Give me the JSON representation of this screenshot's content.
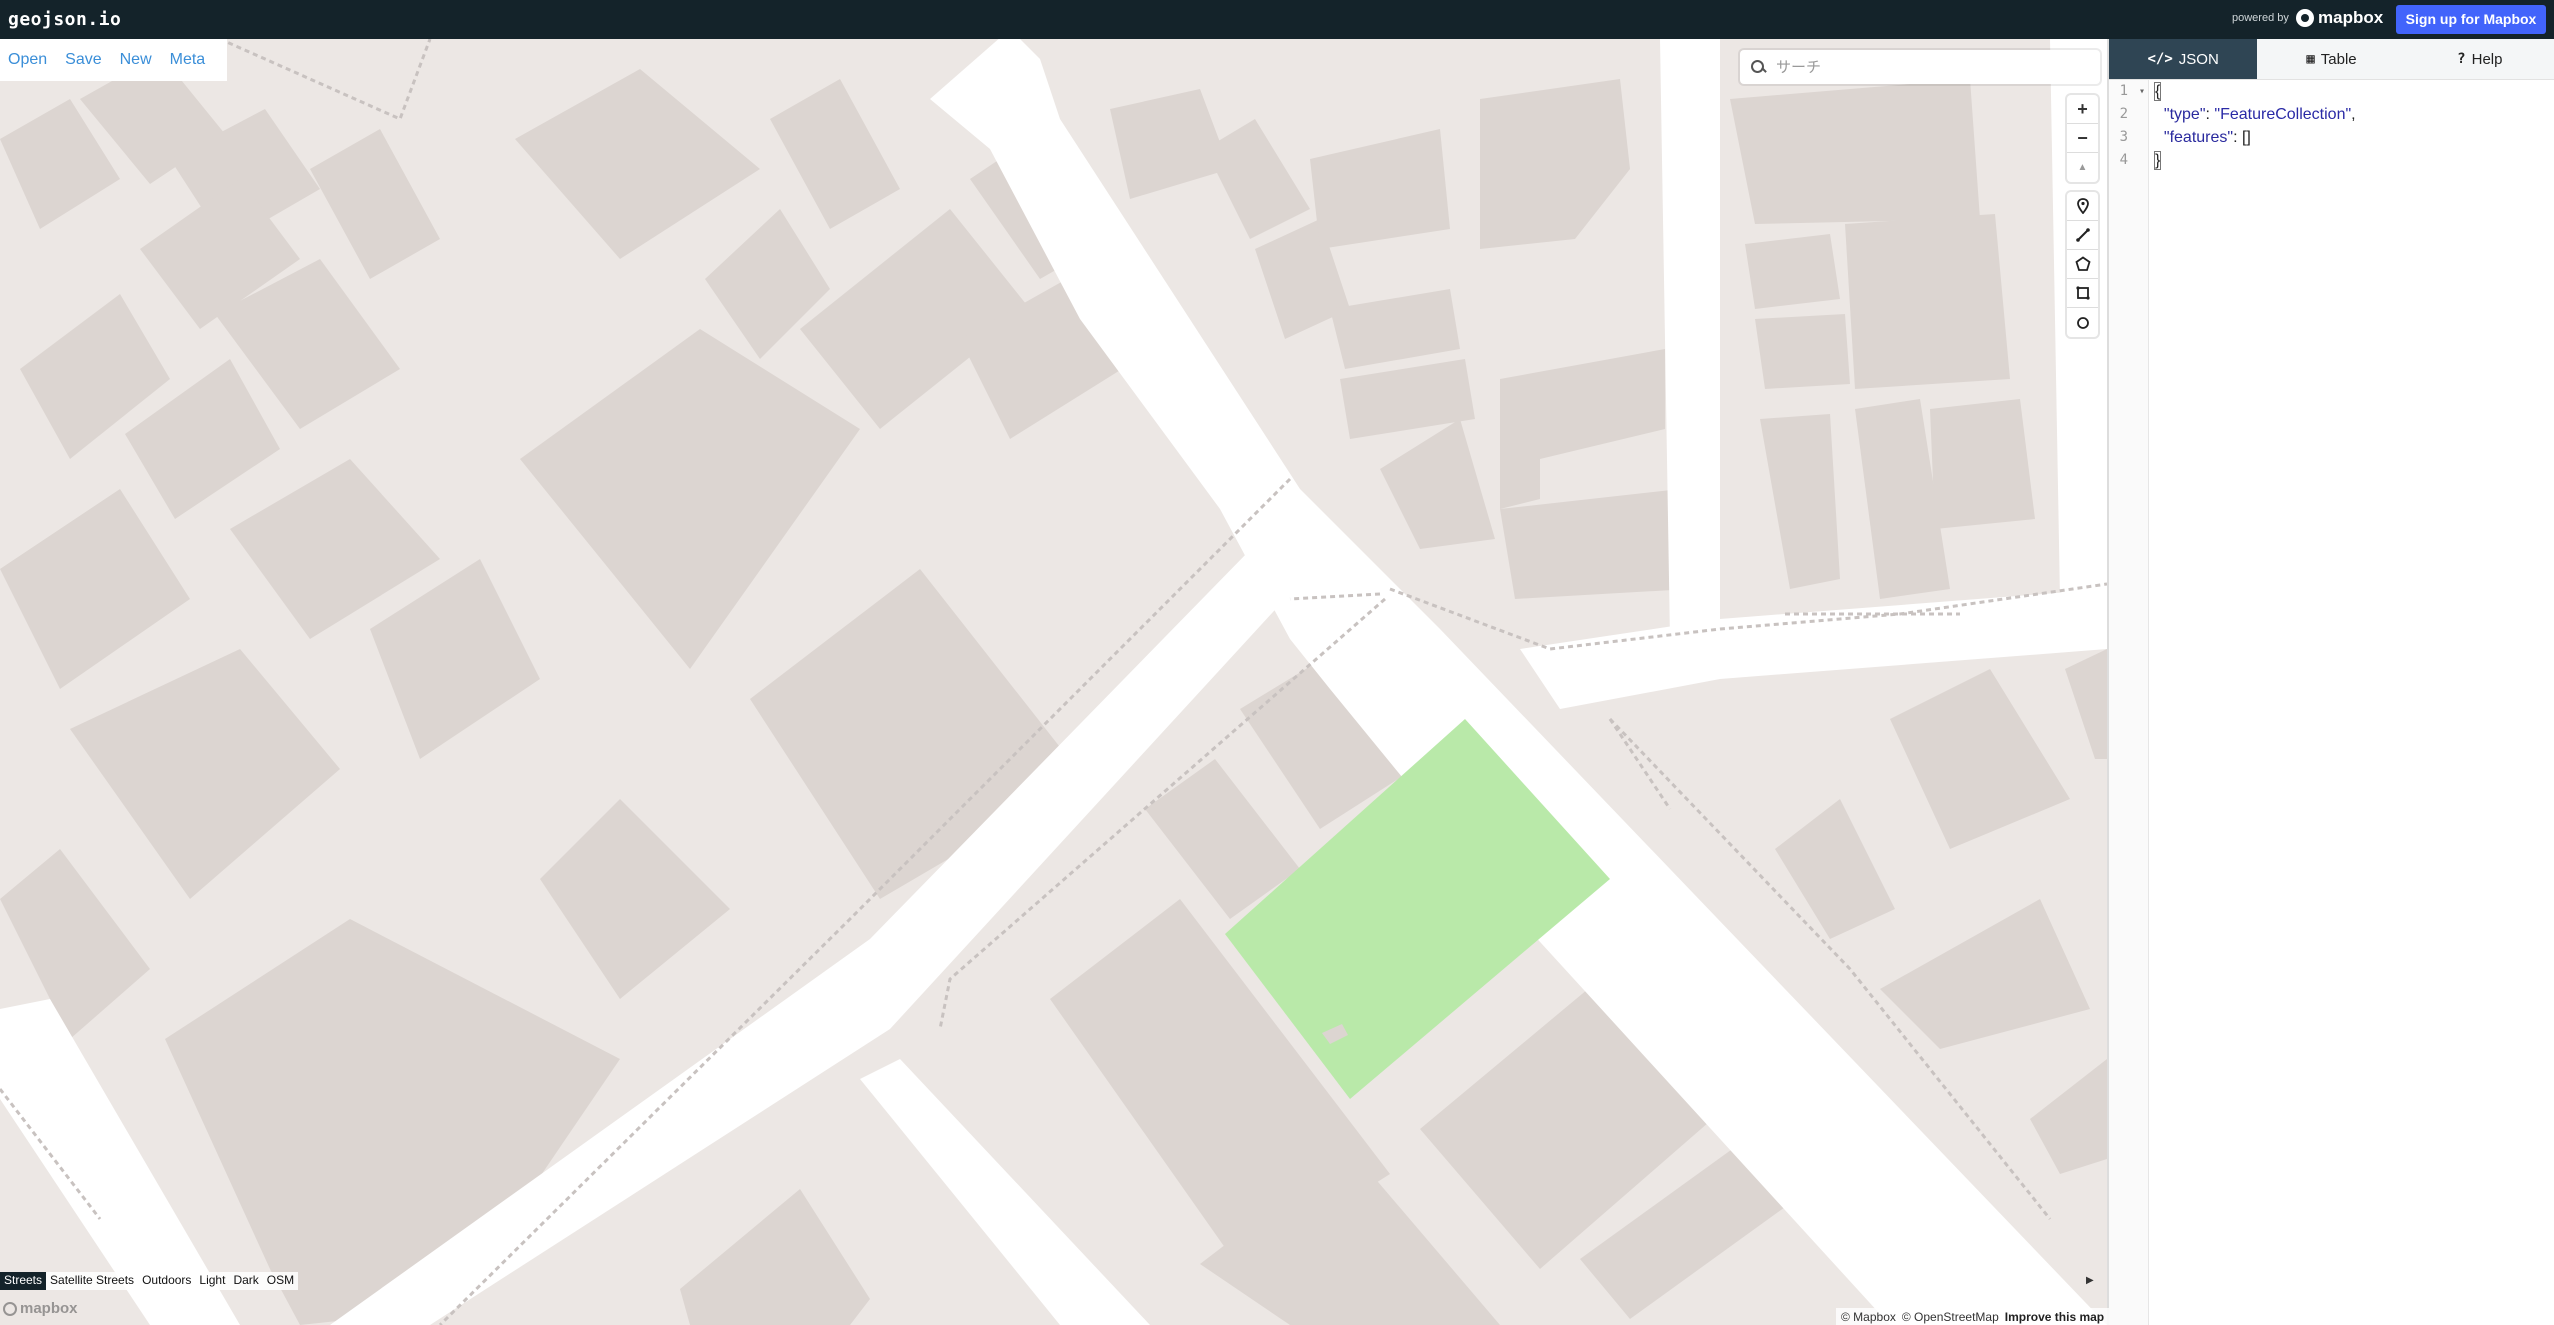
{
  "app": {
    "logo": "geojson.io",
    "powered_by": "powered by",
    "brand": "mapbox",
    "signup": "Sign up for Mapbox"
  },
  "menu": [
    "Open",
    "Save",
    "New",
    "Meta"
  ],
  "search": {
    "placeholder": "サーチ"
  },
  "map_controls": {
    "zoom_in": "+",
    "zoom_out": "−",
    "compass": "▲"
  },
  "draw_tools": [
    "marker-icon",
    "line-icon",
    "polygon-icon",
    "rectangle-icon",
    "circle-icon"
  ],
  "styles": {
    "active": "Streets",
    "items": [
      "Streets",
      "Satellite Streets",
      "Outdoors",
      "Light",
      "Dark",
      "OSM"
    ]
  },
  "attribution": {
    "mapbox": "© Mapbox",
    "osm": "© OpenStreetMap",
    "improve": "Improve this map",
    "wordmark": "mapbox"
  },
  "map_colors": {
    "background": "#ece7e4",
    "building": "#dcd5d1",
    "road": "#ffffff",
    "feature_fill": "#b9e9a9"
  },
  "pane": {
    "tabs": [
      {
        "label": "JSON",
        "icon": "code-icon",
        "active": true
      },
      {
        "label": "Table",
        "icon": "table-icon",
        "active": false
      },
      {
        "label": "Help",
        "icon": "help-icon",
        "active": false
      }
    ],
    "lines": [
      "1",
      "2",
      "3",
      "4"
    ],
    "code": {
      "l1": "{",
      "l2_key": "\"type\"",
      "l2_sep": ": ",
      "l2_val": "\"FeatureCollection\"",
      "l2_end": ",",
      "l3_key": "\"features\"",
      "l3_sep": ": ",
      "l3_val": "[]",
      "l4": "}"
    }
  }
}
